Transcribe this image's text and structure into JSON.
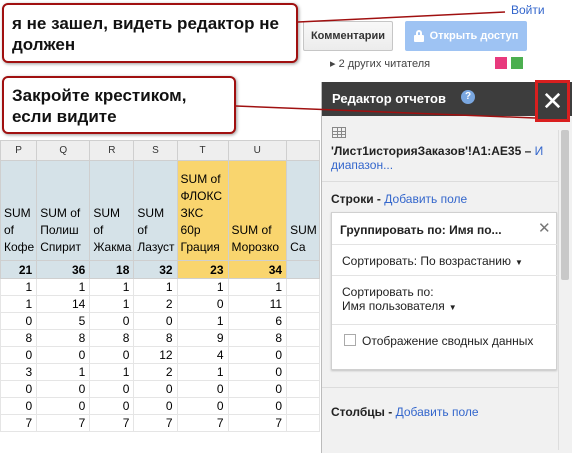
{
  "topbar": {
    "login": "Войти",
    "comments": "Комментарии",
    "share": "Открыть доступ",
    "readers": "▸  2 других читателя"
  },
  "callouts": {
    "top": "я не зашел, видеть редактор не должен",
    "close": "Закройте крестиком, если видите"
  },
  "grid": {
    "columns": [
      "P",
      "Q",
      "R",
      "S",
      "T",
      "U",
      ""
    ],
    "headers": [
      "SUM of Кофе",
      "SUM of Полиш Спирит",
      "SUM of Жакма",
      "SUM of Лазуст",
      "SUM of ФЛОКС ЗКС 60р Грация",
      "SUM of Морозко",
      "SUM Са"
    ],
    "totals": [
      "21",
      "36",
      "18",
      "32",
      "23",
      "34",
      ""
    ],
    "rows": [
      [
        "1",
        "1",
        "1",
        "1",
        "1",
        "1",
        ""
      ],
      [
        "1",
        "14",
        "1",
        "2",
        "0",
        "11",
        ""
      ],
      [
        "0",
        "5",
        "0",
        "0",
        "1",
        "6",
        ""
      ],
      [
        "8",
        "8",
        "8",
        "8",
        "9",
        "8",
        ""
      ],
      [
        "0",
        "0",
        "0",
        "12",
        "4",
        "0",
        ""
      ],
      [
        "3",
        "1",
        "1",
        "2",
        "1",
        "0",
        ""
      ],
      [
        "0",
        "0",
        "0",
        "0",
        "0",
        "0",
        ""
      ],
      [
        "0",
        "0",
        "0",
        "0",
        "0",
        "0",
        ""
      ],
      [
        "7",
        "7",
        "7",
        "7",
        "7",
        "7",
        ""
      ]
    ]
  },
  "panel": {
    "title": "Редактор отчетов",
    "help": "?",
    "close": "✕",
    "range_text": "'Лист1историяЗаказов'!A1:AE35 –",
    "range_link": "И",
    "range_link2": "диапазон...",
    "rows_label": "Строки",
    "add_field": "Добавить поле",
    "cols_label": "Столбцы",
    "card": {
      "title": "Группировать по: Имя по...",
      "close": "✕",
      "sort": "Сортировать: По возрастанию",
      "sortby_label": "Сортировать по:",
      "sortby_value": "Имя пользователя",
      "checkbox_label": "Отображение сводных данных"
    }
  },
  "colors": {
    "callout_border": "#a01010",
    "close_highlight": "#d91f1f",
    "header_fill": "#d5e2e8",
    "yellow_fill": "#f9d56e",
    "panel_dark": "#3d3d3d",
    "link": "#3366cc",
    "share_button": "#9ec3f3"
  }
}
